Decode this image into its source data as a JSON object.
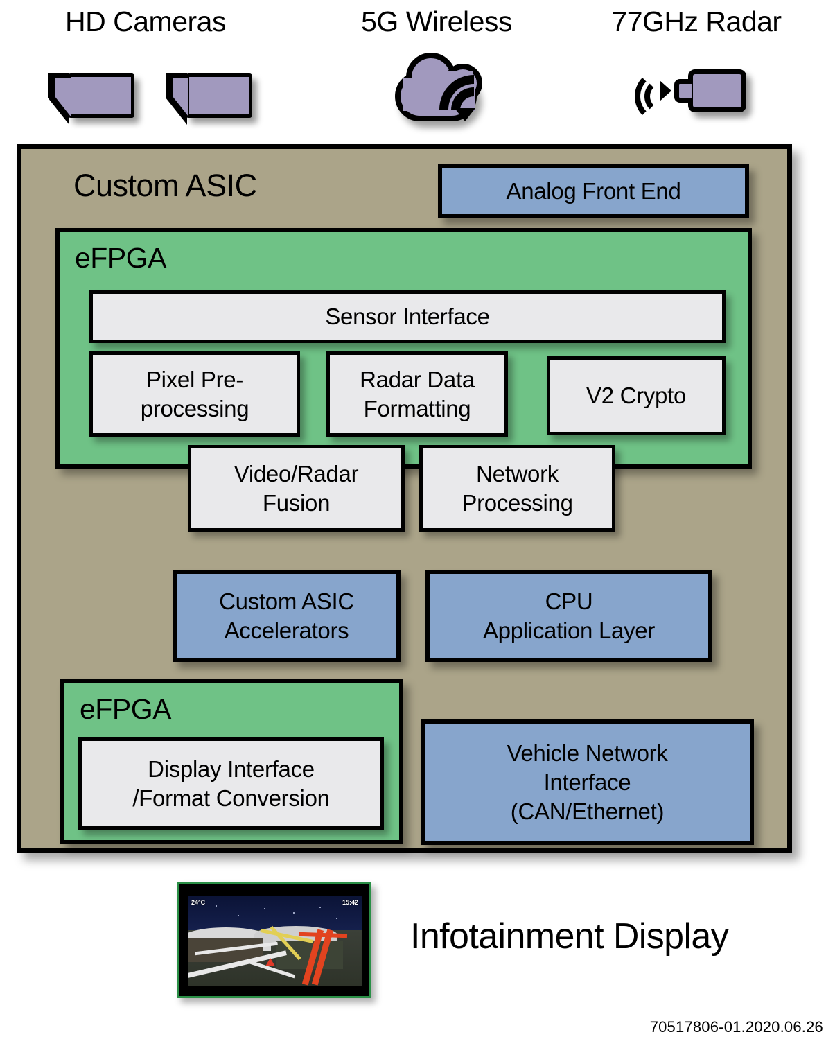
{
  "sensors": [
    {
      "label": "HD Cameras",
      "icon": "camera-icon"
    },
    {
      "label": "5G Wireless",
      "icon": "cloud-wifi-icon"
    },
    {
      "label": "77GHz Radar",
      "icon": "radar-icon"
    }
  ],
  "asic": {
    "title": "Custom ASIC",
    "analog_front_end": "Analog Front End",
    "efpga_top": {
      "title": "eFPGA",
      "sensor_interface": "Sensor Interface",
      "blocks_row1": [
        "Pixel Pre-\nprocessing",
        "Radar Data\nFormatting",
        "V2 Crypto"
      ],
      "blocks_row2": [
        "Video/Radar\nFusion",
        "Network\nProcessing"
      ]
    },
    "mid_blocks": [
      "Custom ASIC\nAccelerators",
      "CPU\nApplication Layer"
    ],
    "efpga_bottom": {
      "title": "eFPGA",
      "block": "Display Interface\n/Format Conversion"
    },
    "vehicle_network": "Vehicle Network\nInterface\n(CAN/Ethernet)"
  },
  "display": {
    "label": "Infotainment Display",
    "osd_temperature": "24°C",
    "osd_time": "15:42"
  },
  "footer": "70517806-01.2020.06.26",
  "colors": {
    "asic_background": "#aba489",
    "efpga_green": "#6fc286",
    "block_blue": "#87a5cc",
    "block_gray": "#e9e9eb",
    "sensor_purple": "#a199be",
    "outline": "#000000",
    "screen_bezel": "#2a8f46"
  }
}
